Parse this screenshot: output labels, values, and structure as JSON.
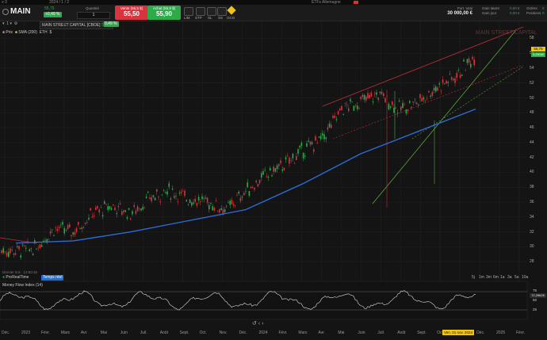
{
  "topstrip": {
    "left": "≡ 0",
    "mid": "2024 / 1 / 2",
    "right": "ETFs Allemagne"
  },
  "toolbar": {
    "symbol": "MAIN",
    "price": "55,75",
    "change": "+0,49 %",
    "qty_label": "Quantité",
    "qty_value": "1",
    "sell_label": "Vente (55,5 $)",
    "sell_price": "55,50",
    "buy_label": "Achat (55,9 $)",
    "buy_price": "55,90",
    "order_types": [
      "LIM",
      "STP",
      "SL",
      "SS",
      "OCO"
    ],
    "portfolio_label": "Port. total",
    "portfolio_value": "30 000,00 €",
    "gain_latent_label": "Gain latent",
    "gain_jour_label": "Gain jour",
    "gain_latent_value": "0,00 €",
    "gain_jour_value": "0,00 €",
    "orders_label": "Ordres",
    "positions_label": "Positions",
    "orders_value": "0",
    "positions_value": "0",
    "colors": {
      "sell": "#d9333f",
      "buy": "#2eaa4a",
      "up": "#2eaa4a",
      "accent_gold": "#f0c419"
    }
  },
  "chart_header": {
    "title": "MAIN STREET CAPITAL [CBOE]",
    "last": "55,75",
    "change": "0,49 %",
    "watermark": "MAIN STREET CAPITAL",
    "legend": [
      "Prix",
      "SMA (200)",
      "ETH",
      "$"
    ],
    "delay": "Dernier tick : 13:50:45",
    "source": "ProRealTime",
    "source_tag": "Temps réel",
    "price_tag": "55,75",
    "sub_tag": "3,25000"
  },
  "indicator": {
    "name": "Money Flow Index (14)",
    "value": "72,29626",
    "levels": [
      "75",
      "50",
      "25"
    ]
  },
  "zoom": [
    "5j",
    "1m",
    "3m",
    "6m",
    "1a",
    "3a",
    "5a",
    "10a"
  ],
  "cursor_date": "Ven. 01 nov. 2024",
  "chart_data": {
    "type": "candlestick",
    "title": "MAIN STREET CAPITAL",
    "y_ticks": [
      28,
      30,
      32,
      34,
      36,
      38,
      40,
      42,
      44,
      46,
      48,
      50,
      52,
      54,
      56,
      58
    ],
    "ylim": [
      26,
      59
    ],
    "x_labels": [
      "Déc.",
      "2023",
      "Févr.",
      "Mars",
      "Avr.",
      "Mai",
      "Juin",
      "Juil.",
      "Août",
      "Sept.",
      "Oct.",
      "Nov.",
      "Déc.",
      "2024",
      "Févr.",
      "Mars",
      "Avr.",
      "Mai",
      "Juin",
      "Juil.",
      "Août",
      "Sept.",
      "Oct.",
      "Nov.",
      "Déc.",
      "2025",
      "Févr."
    ],
    "price_series": [
      [
        "2022-12",
        29.5
      ],
      [
        "2023-01",
        29.8
      ],
      [
        "2023-02",
        32.5
      ],
      [
        "2023-03",
        32.0
      ],
      [
        "2023-04",
        34.5
      ],
      [
        "2023-05",
        35.5
      ],
      [
        "2023-06",
        34.5
      ],
      [
        "2023-07",
        36.5
      ],
      [
        "2023-08",
        37.5
      ],
      [
        "2023-09",
        36.5
      ],
      [
        "2023-10",
        36.0
      ],
      [
        "2023-11",
        35.0
      ],
      [
        "2023-12",
        37.5
      ],
      [
        "2024-01",
        39.5
      ],
      [
        "2024-02",
        41.0
      ],
      [
        "2024-03",
        43.0
      ],
      [
        "2024-04",
        44.5
      ],
      [
        "2024-05",
        48.5
      ],
      [
        "2024-06",
        49.5
      ],
      [
        "2024-07",
        50.5
      ],
      [
        "2024-08",
        48.5
      ],
      [
        "2024-09",
        49.5
      ],
      [
        "2024-10",
        51.5
      ],
      [
        "2024-11",
        53.0
      ],
      [
        "2024-12",
        55.75
      ]
    ],
    "sma200": [
      [
        "2022-12",
        30.5
      ],
      [
        "2023-03",
        30.8
      ],
      [
        "2023-06",
        32.0
      ],
      [
        "2023-09",
        33.5
      ],
      [
        "2023-12",
        35.0
      ],
      [
        "2024-03",
        38.5
      ],
      [
        "2024-06",
        42.5
      ],
      [
        "2024-09",
        45.5
      ],
      [
        "2024-12",
        48.5
      ]
    ],
    "mfi_levels": [
      75,
      50,
      25
    ],
    "mfi_last": 72.3
  }
}
